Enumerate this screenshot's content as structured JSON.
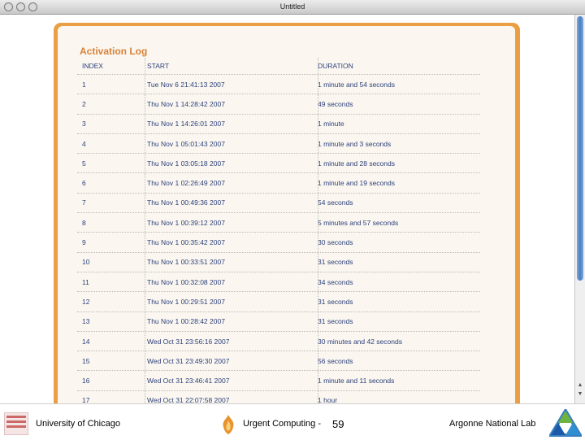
{
  "window": {
    "title": "Untitled"
  },
  "log": {
    "title": "Activation Log",
    "headers": [
      "INDEX",
      "START",
      "DURATION"
    ],
    "rows": [
      [
        "1",
        "Tue Nov 6 21:41:13 2007",
        "1 minute and 54 seconds"
      ],
      [
        "2",
        "Thu Nov 1 14:28:42 2007",
        "49 seconds"
      ],
      [
        "3",
        "Thu Nov 1 14:26:01 2007",
        "1 minute"
      ],
      [
        "4",
        "Thu Nov 1 05:01:43 2007",
        "1 minute and 3 seconds"
      ],
      [
        "5",
        "Thu Nov 1 03:05:18 2007",
        "1 minute and 28 seconds"
      ],
      [
        "6",
        "Thu Nov 1 02:26:49 2007",
        "1 minute and 19 seconds"
      ],
      [
        "7",
        "Thu Nov 1 00:49:36 2007",
        "54 seconds"
      ],
      [
        "8",
        "Thu Nov 1 00:39:12 2007",
        "5 minutes and 57 seconds"
      ],
      [
        "9",
        "Thu Nov 1 00:35:42 2007",
        "30 seconds"
      ],
      [
        "10",
        "Thu Nov 1 00:33:51 2007",
        "31 seconds"
      ],
      [
        "11",
        "Thu Nov 1 00:32:08 2007",
        "34 seconds"
      ],
      [
        "12",
        "Thu Nov 1 00:29:51 2007",
        "31 seconds"
      ],
      [
        "13",
        "Thu Nov 1 00:28:42 2007",
        "31 seconds"
      ],
      [
        "14",
        "Wed Oct 31 23:56:16 2007",
        "30 minutes and 42 seconds"
      ],
      [
        "15",
        "Wed Oct 31 23:49:30 2007",
        "56 seconds"
      ],
      [
        "16",
        "Wed Oct 31 23:46:41 2007",
        "1 minute and 11 seconds"
      ],
      [
        "17",
        "Wed Oct 31 22:07:58 2007",
        "1 hour"
      ]
    ]
  },
  "footer": {
    "left": "University of Chicago",
    "middle": "Urgent Computing -",
    "slide_number": "59",
    "right": "Argonne National Lab"
  },
  "colors": {
    "frame": "#eb9f44",
    "title": "#d8823a",
    "text": "#2b3f7a",
    "scroll_thumb": "#4a7fc4"
  }
}
